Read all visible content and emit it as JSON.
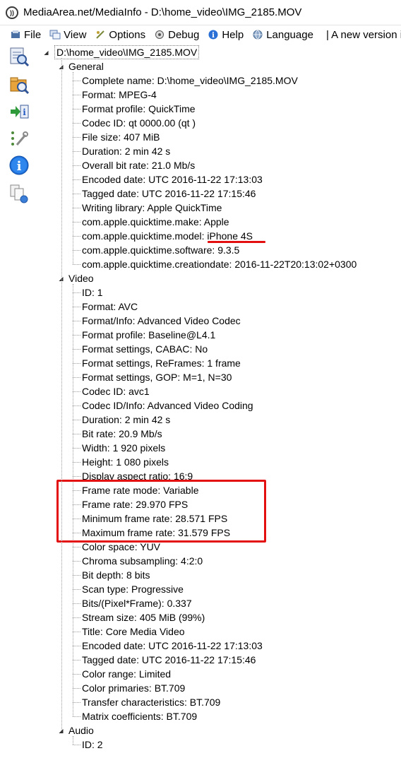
{
  "window": {
    "title": "MediaArea.net/MediaInfo - D:\\home_video\\IMG_2185.MOV"
  },
  "menu": [
    {
      "label": "File",
      "icon": "file-icon"
    },
    {
      "label": "View",
      "icon": "view-icon"
    },
    {
      "label": "Options",
      "icon": "options-icon"
    },
    {
      "label": "Debug",
      "icon": "debug-icon"
    },
    {
      "label": "Help",
      "icon": "help-icon"
    },
    {
      "label": "Language",
      "icon": "language-icon"
    }
  ],
  "menu_notice": "| A new version i",
  "tree": {
    "root": "D:\\home_video\\IMG_2185.MOV",
    "general": {
      "label": "General",
      "items": [
        "Complete name: D:\\home_video\\IMG_2185.MOV",
        "Format: MPEG-4",
        "Format profile: QuickTime",
        "Codec ID: qt   0000.00 (qt  )",
        "File size: 407 MiB",
        "Duration: 2 min 42 s",
        "Overall bit rate: 21.0 Mb/s",
        "Encoded date: UTC 2016-11-22 17:13:03",
        "Tagged date: UTC 2016-11-22 17:15:46",
        "Writing library: Apple QuickTime",
        "com.apple.quicktime.make: Apple",
        "com.apple.quicktime.model: iPhone 4S",
        "com.apple.quicktime.software: 9.3.5",
        "com.apple.quicktime.creationdate: 2016-11-22T20:13:02+0300"
      ]
    },
    "video": {
      "label": "Video",
      "items": [
        "ID: 1",
        "Format: AVC",
        "Format/Info: Advanced Video Codec",
        "Format profile: Baseline@L4.1",
        "Format settings, CABAC: No",
        "Format settings, ReFrames: 1 frame",
        "Format settings, GOP: M=1, N=30",
        "Codec ID: avc1",
        "Codec ID/Info: Advanced Video Coding",
        "Duration: 2 min 42 s",
        "Bit rate: 20.9 Mb/s",
        "Width: 1 920 pixels",
        "Height: 1 080 pixels",
        "Display aspect ratio: 16:9",
        "Frame rate mode: Variable",
        "Frame rate: 29.970 FPS",
        "Minimum frame rate: 28.571 FPS",
        "Maximum frame rate: 31.579 FPS",
        "Color space: YUV",
        "Chroma subsampling: 4:2:0",
        "Bit depth: 8 bits",
        "Scan type: Progressive",
        "Bits/(Pixel*Frame): 0.337",
        "Stream size: 405 MiB (99%)",
        "Title: Core Media Video",
        "Encoded date: UTC 2016-11-22 17:13:03",
        "Tagged date: UTC 2016-11-22 17:15:46",
        "Color range: Limited",
        "Color primaries: BT.709",
        "Transfer characteristics: BT.709",
        "Matrix coefficients: BT.709"
      ]
    },
    "audio": {
      "label": "Audio",
      "items": [
        "ID: 2"
      ]
    }
  },
  "sidebar_tools": [
    "sheet-view-icon",
    "folder-open-icon",
    "export-info-icon",
    "settings-tools-icon",
    "about-info-icon",
    "copy-compare-icon"
  ],
  "colors": {
    "annotation_red": "#e21010",
    "tree_line": "#9a9a9a"
  }
}
